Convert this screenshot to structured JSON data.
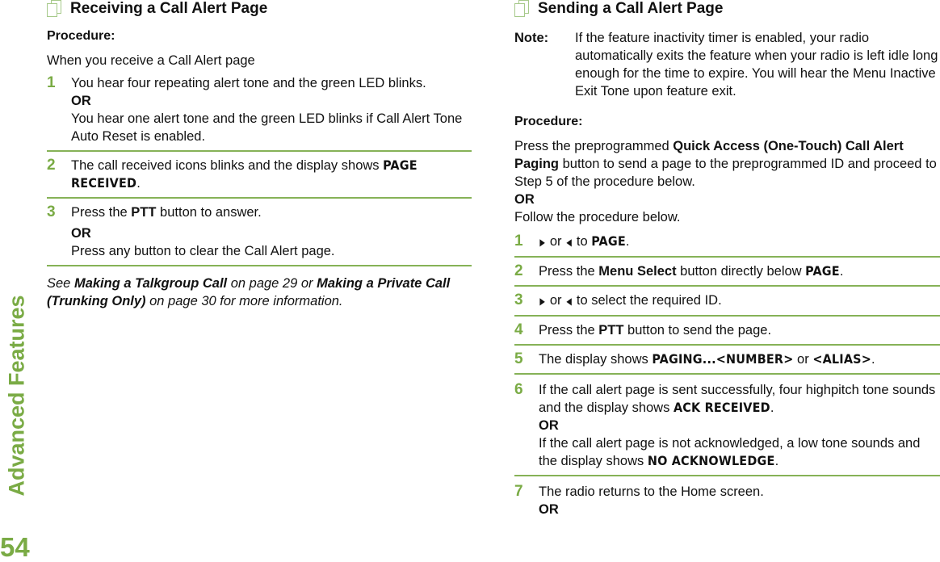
{
  "side_tab": {
    "label": "Advanced Features",
    "page_number": "54"
  },
  "left": {
    "title": "Receiving a Call Alert Page",
    "procedure_label": "Procedure:",
    "intro": "When you receive a Call Alert page",
    "steps": [
      {
        "num": "1",
        "line1": "You hear four repeating alert tone and the green LED blinks.",
        "or": "OR",
        "line2": "You hear one alert tone and the green LED blinks if Call Alert Tone Auto Reset is enabled."
      },
      {
        "num": "2",
        "text": "The call received icons blinks and the display shows ",
        "display": "PAGE RECEIVED",
        "end": "."
      },
      {
        "num": "3",
        "pre": "Press the ",
        "kw": "PTT",
        "post": " button to answer.",
        "or": "OR",
        "line2": "Press any button to clear the Call Alert page."
      }
    ],
    "see": {
      "pre": "See ",
      "link1": "Making a Talkgroup Call",
      "mid": " on page 29 or ",
      "link2": "Making a Private Call (Trunking Only)",
      "post": " on page 30 for more information."
    }
  },
  "right": {
    "title": "Sending a Call Alert Page",
    "note_label": "Note:",
    "note_text": "If the feature inactivity timer is enabled, your radio automatically exits the feature when your radio is left idle long enough for the time to expire. You will hear the Menu Inactive Exit Tone upon feature exit.",
    "procedure_label": "Procedure:",
    "intro": {
      "pre": "Press the preprogrammed ",
      "kw": "Quick Access (One-Touch) Call Alert Paging",
      "post": " button to send a page to the preprogrammed ID and proceed to Step 5 of the procedure below.",
      "or": "OR",
      "alt": "Follow the procedure below."
    },
    "steps": [
      {
        "num": "1",
        "right_arrow": "▶",
        "or": " or ",
        "left_arrow": "◀",
        "to": " to ",
        "display": "PAGE",
        "end": "."
      },
      {
        "num": "2",
        "pre": "Press the ",
        "kw": "Menu Select",
        "post": " button directly below ",
        "display": "PAGE",
        "end": "."
      },
      {
        "num": "3",
        "right_arrow": "▶",
        "or": " or ",
        "left_arrow": "◀",
        "post": " to select the required ID."
      },
      {
        "num": "4",
        "pre": "Press the ",
        "kw": "PTT",
        "post": " button to send the page."
      },
      {
        "num": "5",
        "pre": "The display shows ",
        "display1": "PAGING...<NUMBER>",
        "or": " or ",
        "display2": "<ALIAS>",
        "end": "."
      },
      {
        "num": "6",
        "line1": "If the call alert page is sent successfully, four highpitch tone sounds and the display shows ",
        "display1": "ACK RECEIVED",
        "end1": ".",
        "or": "OR",
        "line2": "If the call alert page is not acknowledged, a low tone sounds and the display shows ",
        "display2": "NO ACKNOWLEDGE",
        "end2": "."
      },
      {
        "num": "7",
        "line1": "The radio returns to the Home screen.",
        "or": "OR"
      }
    ]
  }
}
